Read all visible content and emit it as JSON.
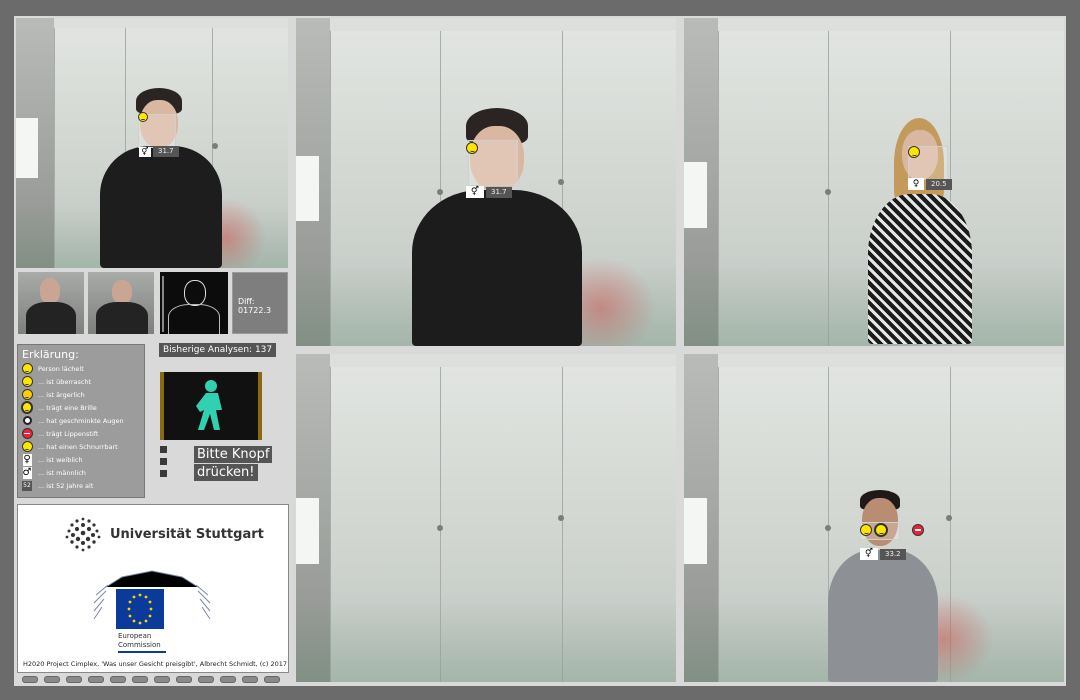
{
  "cameras": [
    {
      "id": "cam-top-left",
      "age": "31.7"
    },
    {
      "id": "cam-top-middle",
      "age": "31.7"
    },
    {
      "id": "cam-top-right",
      "age": "20.5"
    },
    {
      "id": "cam-bottom-middle"
    },
    {
      "id": "cam-bottom-right",
      "age": "33.2"
    }
  ],
  "diff": {
    "label": "Diff: 01722.3"
  },
  "legend": {
    "title": "Erklärung:",
    "items": [
      {
        "icon": "smiley-icon",
        "text": "Person lächelt"
      },
      {
        "icon": "surprised-icon",
        "text": "... ist überrascht"
      },
      {
        "icon": "angry-icon",
        "text": "... ist ärgerlich"
      },
      {
        "icon": "glasses-icon",
        "text": "... trägt eine Brille"
      },
      {
        "icon": "eye-makeup-icon",
        "text": "... hat geschminkte Augen"
      },
      {
        "icon": "lipstick-icon",
        "text": "... trägt Lippenstift"
      },
      {
        "icon": "mustache-icon",
        "text": "... hat einen Schnurrbart"
      },
      {
        "icon": "female-icon",
        "text": "... ist weiblich"
      },
      {
        "icon": "male-icon",
        "text": "... ist männlich"
      },
      {
        "icon": "age-icon",
        "icon_text": "52",
        "text": "... ist 52 Jahre alt"
      }
    ]
  },
  "analysen": {
    "label": "Bisherige Analysen: 137"
  },
  "prompt": {
    "line1": "Bitte Knopf",
    "line2": "drücken!"
  },
  "logos": {
    "university": "Universität Stuttgart",
    "eu_line1": "European",
    "eu_line2": "Commission",
    "footer": "H2020 Project Cimplex, 'Was unser Gesicht preisgibt', Albrecht Schmidt, (c) 2017"
  },
  "colors": {
    "background": "#6b6b6b",
    "panel": "#d9d9d9",
    "smiley": "#ffe600",
    "eu_blue": "#0a3a9a",
    "eu_star": "#ffd400"
  }
}
